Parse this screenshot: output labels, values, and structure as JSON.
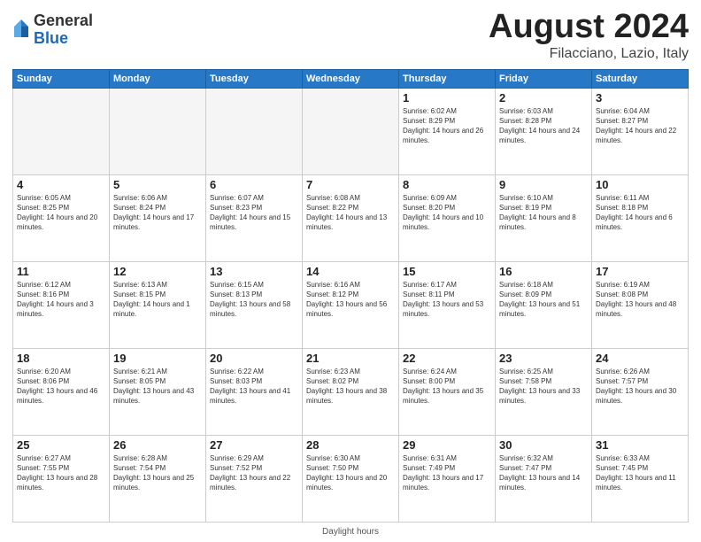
{
  "header": {
    "logo_line1": "General",
    "logo_line2": "Blue",
    "main_title": "August 2024",
    "sub_title": "Filacciano, Lazio, Italy"
  },
  "weekdays": [
    "Sunday",
    "Monday",
    "Tuesday",
    "Wednesday",
    "Thursday",
    "Friday",
    "Saturday"
  ],
  "weeks": [
    [
      {
        "day": "",
        "info": ""
      },
      {
        "day": "",
        "info": ""
      },
      {
        "day": "",
        "info": ""
      },
      {
        "day": "",
        "info": ""
      },
      {
        "day": "1",
        "info": "Sunrise: 6:02 AM\nSunset: 8:29 PM\nDaylight: 14 hours and 26 minutes."
      },
      {
        "day": "2",
        "info": "Sunrise: 6:03 AM\nSunset: 8:28 PM\nDaylight: 14 hours and 24 minutes."
      },
      {
        "day": "3",
        "info": "Sunrise: 6:04 AM\nSunset: 8:27 PM\nDaylight: 14 hours and 22 minutes."
      }
    ],
    [
      {
        "day": "4",
        "info": "Sunrise: 6:05 AM\nSunset: 8:25 PM\nDaylight: 14 hours and 20 minutes."
      },
      {
        "day": "5",
        "info": "Sunrise: 6:06 AM\nSunset: 8:24 PM\nDaylight: 14 hours and 17 minutes."
      },
      {
        "day": "6",
        "info": "Sunrise: 6:07 AM\nSunset: 8:23 PM\nDaylight: 14 hours and 15 minutes."
      },
      {
        "day": "7",
        "info": "Sunrise: 6:08 AM\nSunset: 8:22 PM\nDaylight: 14 hours and 13 minutes."
      },
      {
        "day": "8",
        "info": "Sunrise: 6:09 AM\nSunset: 8:20 PM\nDaylight: 14 hours and 10 minutes."
      },
      {
        "day": "9",
        "info": "Sunrise: 6:10 AM\nSunset: 8:19 PM\nDaylight: 14 hours and 8 minutes."
      },
      {
        "day": "10",
        "info": "Sunrise: 6:11 AM\nSunset: 8:18 PM\nDaylight: 14 hours and 6 minutes."
      }
    ],
    [
      {
        "day": "11",
        "info": "Sunrise: 6:12 AM\nSunset: 8:16 PM\nDaylight: 14 hours and 3 minutes."
      },
      {
        "day": "12",
        "info": "Sunrise: 6:13 AM\nSunset: 8:15 PM\nDaylight: 14 hours and 1 minute."
      },
      {
        "day": "13",
        "info": "Sunrise: 6:15 AM\nSunset: 8:13 PM\nDaylight: 13 hours and 58 minutes."
      },
      {
        "day": "14",
        "info": "Sunrise: 6:16 AM\nSunset: 8:12 PM\nDaylight: 13 hours and 56 minutes."
      },
      {
        "day": "15",
        "info": "Sunrise: 6:17 AM\nSunset: 8:11 PM\nDaylight: 13 hours and 53 minutes."
      },
      {
        "day": "16",
        "info": "Sunrise: 6:18 AM\nSunset: 8:09 PM\nDaylight: 13 hours and 51 minutes."
      },
      {
        "day": "17",
        "info": "Sunrise: 6:19 AM\nSunset: 8:08 PM\nDaylight: 13 hours and 48 minutes."
      }
    ],
    [
      {
        "day": "18",
        "info": "Sunrise: 6:20 AM\nSunset: 8:06 PM\nDaylight: 13 hours and 46 minutes."
      },
      {
        "day": "19",
        "info": "Sunrise: 6:21 AM\nSunset: 8:05 PM\nDaylight: 13 hours and 43 minutes."
      },
      {
        "day": "20",
        "info": "Sunrise: 6:22 AM\nSunset: 8:03 PM\nDaylight: 13 hours and 41 minutes."
      },
      {
        "day": "21",
        "info": "Sunrise: 6:23 AM\nSunset: 8:02 PM\nDaylight: 13 hours and 38 minutes."
      },
      {
        "day": "22",
        "info": "Sunrise: 6:24 AM\nSunset: 8:00 PM\nDaylight: 13 hours and 35 minutes."
      },
      {
        "day": "23",
        "info": "Sunrise: 6:25 AM\nSunset: 7:58 PM\nDaylight: 13 hours and 33 minutes."
      },
      {
        "day": "24",
        "info": "Sunrise: 6:26 AM\nSunset: 7:57 PM\nDaylight: 13 hours and 30 minutes."
      }
    ],
    [
      {
        "day": "25",
        "info": "Sunrise: 6:27 AM\nSunset: 7:55 PM\nDaylight: 13 hours and 28 minutes."
      },
      {
        "day": "26",
        "info": "Sunrise: 6:28 AM\nSunset: 7:54 PM\nDaylight: 13 hours and 25 minutes."
      },
      {
        "day": "27",
        "info": "Sunrise: 6:29 AM\nSunset: 7:52 PM\nDaylight: 13 hours and 22 minutes."
      },
      {
        "day": "28",
        "info": "Sunrise: 6:30 AM\nSunset: 7:50 PM\nDaylight: 13 hours and 20 minutes."
      },
      {
        "day": "29",
        "info": "Sunrise: 6:31 AM\nSunset: 7:49 PM\nDaylight: 13 hours and 17 minutes."
      },
      {
        "day": "30",
        "info": "Sunrise: 6:32 AM\nSunset: 7:47 PM\nDaylight: 13 hours and 14 minutes."
      },
      {
        "day": "31",
        "info": "Sunrise: 6:33 AM\nSunset: 7:45 PM\nDaylight: 13 hours and 11 minutes."
      }
    ]
  ],
  "footer": {
    "label": "Daylight hours"
  }
}
